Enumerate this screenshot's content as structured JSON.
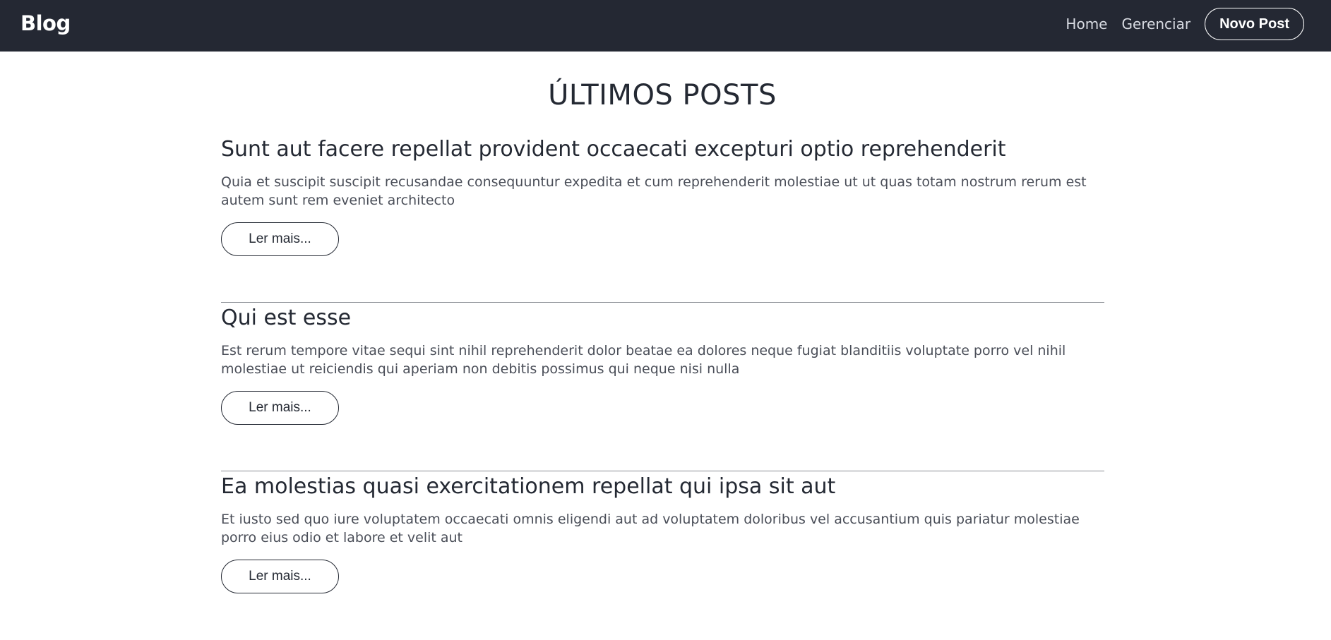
{
  "navbar": {
    "brand": "Blog",
    "links": [
      {
        "label": "Home"
      },
      {
        "label": "Gerenciar"
      }
    ],
    "cta_label": "Novo Post"
  },
  "main": {
    "title": "ÚLTIMOS POSTS",
    "posts": [
      {
        "title": "Sunt aut facere repellat provident occaecati excepturi optio reprehenderit",
        "body": "Quia et suscipit suscipit recusandae consequuntur expedita et cum reprehenderit molestiae ut ut quas totam nostrum rerum est autem sunt rem eveniet architecto",
        "button_label": "Ler mais..."
      },
      {
        "title": "Qui est esse",
        "body": "Est rerum tempore vitae sequi sint nihil reprehenderit dolor beatae ea dolores neque fugiat blanditiis voluptate porro vel nihil molestiae ut reiciendis qui aperiam non debitis possimus qui neque nisi nulla",
        "button_label": "Ler mais..."
      },
      {
        "title": "Ea molestias quasi exercitationem repellat qui ipsa sit aut",
        "body": "Et iusto sed quo iure voluptatem occaecati omnis eligendi aut ad voluptatem doloribus vel accusantium quis pariatur molestiae porro eius odio et labore et velit aut",
        "button_label": "Ler mais..."
      }
    ]
  },
  "colors": {
    "navbar_bg": "#242833",
    "text_dark": "#242933",
    "text_body": "#4a4e58",
    "divider": "#8a8d94"
  }
}
